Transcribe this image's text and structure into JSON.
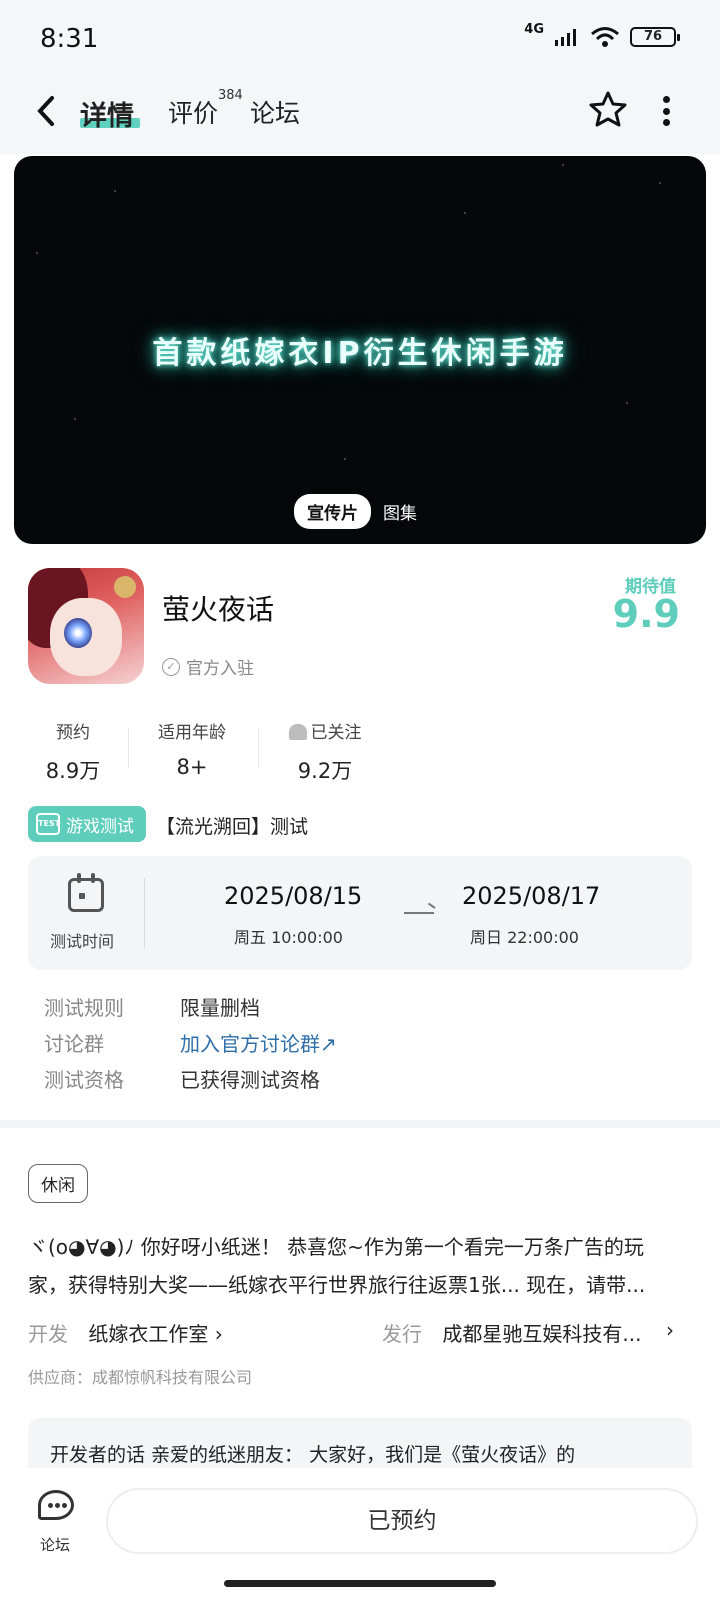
{
  "status": {
    "time": "8:31",
    "network": "4G",
    "battery": "76"
  },
  "nav": {
    "tabs": [
      {
        "label": "详情",
        "active": true
      },
      {
        "label": "评价",
        "badge": "384"
      },
      {
        "label": "论坛"
      }
    ]
  },
  "banner": {
    "title": "首款纸嫁衣IP衍生休闲手游",
    "media_tabs": [
      "宣传片",
      "图集"
    ]
  },
  "game": {
    "name": "萤火夜话",
    "official": "官方入驻",
    "expect_label": "期待值",
    "expect_value": "9.9",
    "stats": [
      {
        "label": "预约",
        "value": "8.9万"
      },
      {
        "label": "适用年龄",
        "value": "8+"
      },
      {
        "label": "已关注",
        "value": "9.2万"
      }
    ]
  },
  "test": {
    "badge": "游戏测试",
    "title": "【流光溯回】测试",
    "time_label": "测试时间",
    "start": {
      "date": "2025/08/15",
      "time": "周五  10:00:00"
    },
    "end": {
      "date": "2025/08/17",
      "time": "周日  22:00:00"
    },
    "rows": [
      {
        "key": "测试规则",
        "value": "限量删档"
      },
      {
        "key": "讨论群",
        "value": "加入官方讨论群↗"
      },
      {
        "key": "测试资格",
        "value": "已获得测试资格"
      }
    ]
  },
  "about": {
    "tag": "休闲",
    "desc_line1": "ヾ(o◕∀◕)ﾉ 你好呀小纸迷！ 恭喜您~作为第一个看完一万条广告的玩",
    "desc_line2": "家，获得特别大奖——纸嫁衣平行世界旅行往返票1张... 现在，请带...",
    "developer_key": "开发",
    "developer_val": "纸嫁衣工作室 ›",
    "publisher_key": "发行",
    "publisher_val": "成都星驰互娱科技有...",
    "publisher_arrow": "›",
    "supplier": "供应商：成都惊帆科技有限公司",
    "dev_words": "开发者的话  亲爱的纸迷朋友： 大家好，我们是《萤火夜话》的"
  },
  "bottom": {
    "forum_label": "论坛",
    "reserve_label": "已预约"
  },
  "colors": {
    "accent": "#5fcdbb",
    "link": "#2f6fa8"
  }
}
